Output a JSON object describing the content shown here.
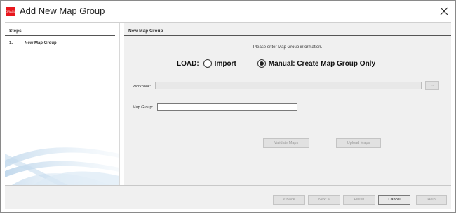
{
  "window": {
    "title": "Add New Map Group",
    "app_icon_text": "ORACLE"
  },
  "steps": {
    "header": "Steps",
    "items": [
      {
        "number": "1.",
        "label": "New Map Group"
      }
    ]
  },
  "main": {
    "header": "New Map Group",
    "intro": "Please enter Map Group information.",
    "load_label": "LOAD:",
    "options": [
      {
        "label": "Import",
        "selected": false
      },
      {
        "label": "Manual: Create Map Group Only",
        "selected": true
      }
    ],
    "workbook": {
      "label": "Workbook:",
      "value": "",
      "browse_label": "..."
    },
    "map_group": {
      "label": "Map Group:",
      "value": ""
    },
    "validate_label": "Validate Maps",
    "upload_label": "Upload Maps"
  },
  "footer": {
    "back_label": "< Back",
    "next_label": "Next >",
    "finish_label": "Finish",
    "cancel_label": "Cancel",
    "help_label": "Help"
  },
  "colors": {
    "brand": "#e8171d",
    "panel_bg": "#f0f0f0",
    "swoosh": "#b8d4ea"
  }
}
